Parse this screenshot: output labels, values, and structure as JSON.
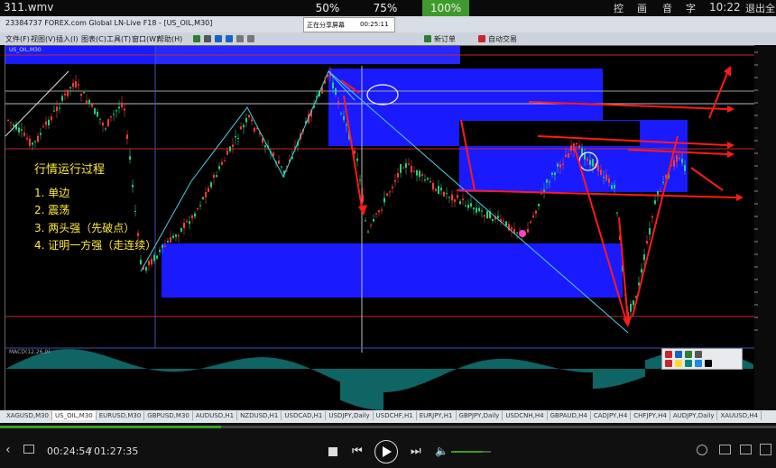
{
  "video": {
    "title": "311.wmv",
    "zoom_options": [
      "50%",
      "75%",
      "100%"
    ],
    "right_controls": [
      "控",
      "画",
      "音",
      "字"
    ],
    "time": "10:22",
    "exit_label": "退出全"
  },
  "platform": {
    "window_title": "23384737 FOREX.com Global LN-Live F18 - [US_OIL,M30]",
    "overlay_text": "正在分享屏幕",
    "overlay_time": "00:25:11",
    "menu": [
      "文件(F)",
      "视图(V)",
      "插入(I)",
      "图表(C)",
      "工具(T)",
      "窗口(W)",
      "帮助(H)"
    ],
    "toolbar_new_order": "新订单",
    "toolbar_auto": "自动交易"
  },
  "chart": {
    "symbol_label": "US_OIL,M30",
    "indicator_label": "MACD(12,26,9)"
  },
  "annotation": {
    "title": "行情运行过程",
    "items": [
      "1. 单边",
      "2. 震荡",
      "3. 两头强（先破点）",
      "4. 证明一方强（走连续）"
    ]
  },
  "bottom_tabs": [
    "XAGUSD,M30",
    "US_OIL,M30",
    "EURUSD,M30",
    "GBPUSD,M30",
    "AUDUSD,H1",
    "NZDUSD,H1",
    "USDCAD,H1",
    "USDJPY,Daily",
    "USDCHF,H1",
    "EURJPY,H1",
    "GBPJPY,Daily",
    "USDCNH,H4",
    "GBPAUD,H4",
    "CADJPY,H4",
    "CHFJPY,H4",
    "AUDJPY,Daily",
    "XAUUSD,H4"
  ],
  "player": {
    "current_time": "00:24:54",
    "total_time": "01:27:35",
    "progress": 0.285,
    "volume": 0.8
  },
  "colors": {
    "accent_green": "#3f9a2c",
    "zone_blue": "#1a1aff",
    "annotation_yellow": "#ffeb3b",
    "arrow_red": "#ff1a1a"
  }
}
